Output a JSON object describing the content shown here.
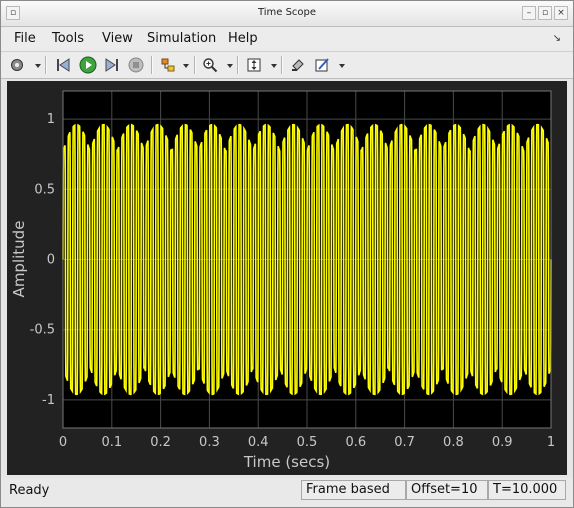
{
  "window": {
    "title": "Time Scope"
  },
  "menu": {
    "file": "File",
    "tools": "Tools",
    "view": "View",
    "simulation": "Simulation",
    "help": "Help"
  },
  "toolbar": {
    "icons": [
      "gear-icon",
      "step-back-icon",
      "run-icon",
      "step-forward-icon",
      "stop-icon",
      "signal-selection-icon",
      "zoom-in-icon",
      "autoscale-icon",
      "highlight-icon",
      "style-icon"
    ]
  },
  "plot": {
    "ylabel": "Amplitude",
    "xlabel": "Time (secs)",
    "background": "#000000",
    "trace_color": "#ffff00",
    "grid_color": "#4a4a4a"
  },
  "chart_data": {
    "type": "line",
    "x_ticks": [
      "0",
      "0.1",
      "0.2",
      "0.3",
      "0.4",
      "0.5",
      "0.6",
      "0.7",
      "0.8",
      "0.9",
      "1"
    ],
    "y_ticks": [
      "1",
      "0.5",
      "0",
      "-0.5",
      "-1"
    ],
    "xlim": [
      0,
      1
    ],
    "ylim": [
      -1.2,
      1.2
    ],
    "grid": true,
    "ylabel": "Amplitude",
    "xlabel": "Time (secs)",
    "series": [
      {
        "signal_freq_hz": 100,
        "amplitude": 0.96,
        "color": "#ffff00"
      }
    ]
  },
  "status": {
    "ready": "Ready",
    "frame_mode": "Frame based",
    "offset": "Offset=10",
    "time": "T=10.000"
  }
}
